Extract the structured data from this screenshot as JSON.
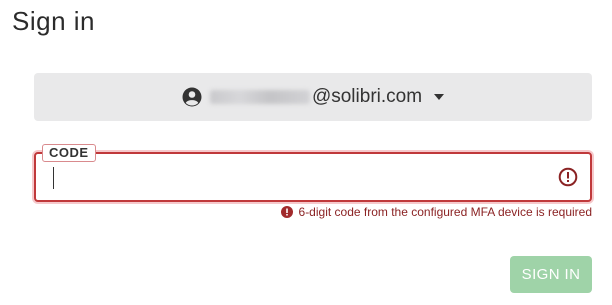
{
  "page": {
    "title": "Sign in"
  },
  "account": {
    "email_domain": "@solibri.com",
    "icon": "user-circle-icon",
    "dropdown_icon": "caret-down-icon"
  },
  "code_field": {
    "label": "CODE",
    "value": "",
    "error_icon": "exclamation-circle-icon",
    "error_message": "6-digit code from the configured MFA device is required"
  },
  "actions": {
    "signin_label": "SIGN IN"
  },
  "colors": {
    "error": "#c0393b",
    "error_text": "#8b2324",
    "signin_disabled": "#9fd3a8",
    "account_bg": "#e9e9ea"
  }
}
